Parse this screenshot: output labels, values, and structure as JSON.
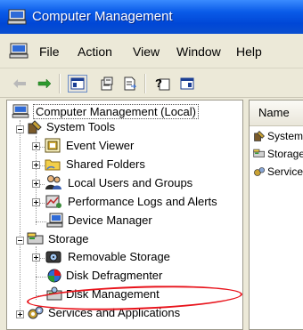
{
  "window": {
    "title": "Computer Management"
  },
  "menubar": {
    "items": [
      "File",
      "Action",
      "View",
      "Window",
      "Help"
    ]
  },
  "toolbar": {
    "buttons": [
      "back-button",
      "forward-button",
      "show-hide-tree-button",
      "properties-button",
      "export-list-button",
      "help-button",
      "show-hide-action-pane-button"
    ]
  },
  "tree": {
    "root": "Computer Management (Local)",
    "system_tools": "System Tools",
    "event_viewer": "Event Viewer",
    "shared_folders": "Shared Folders",
    "local_users": "Local Users and Groups",
    "perf_logs": "Performance Logs and Alerts",
    "device_manager": "Device Manager",
    "storage": "Storage",
    "removable_storage": "Removable Storage",
    "disk_defrag": "Disk Defragmenter",
    "disk_mgmt": "Disk Management",
    "services_apps": "Services and Applications"
  },
  "list": {
    "column_name": "Name",
    "items": [
      "System Tools",
      "Storage",
      "Services and Applications"
    ]
  },
  "colors": {
    "title_bar": "#0a5be8",
    "highlight_ring": "#e8121a",
    "chrome": "#ece9d8"
  }
}
